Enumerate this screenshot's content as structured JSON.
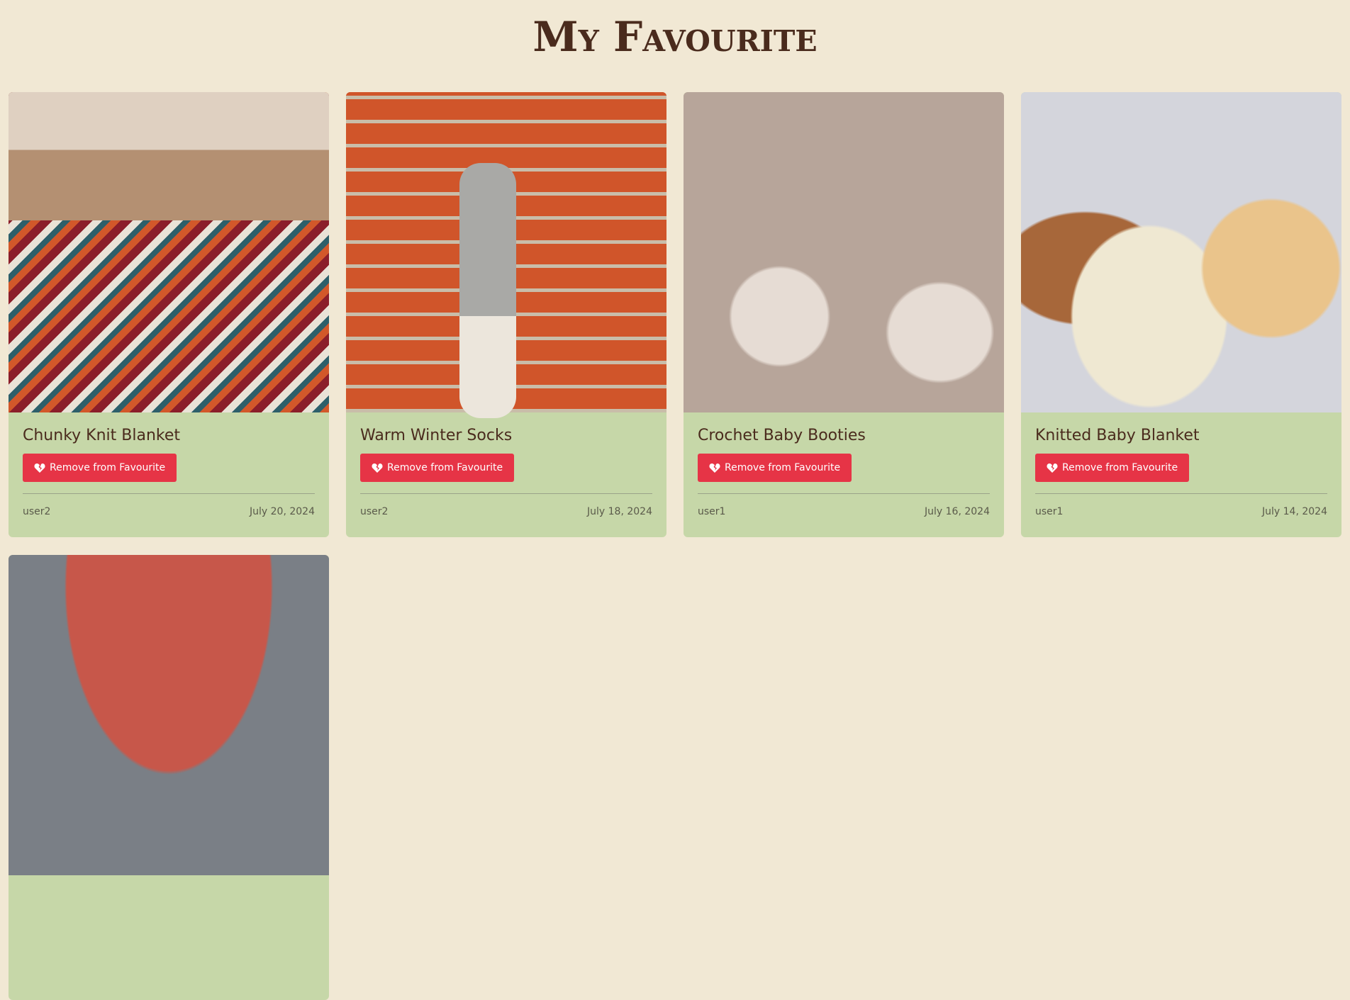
{
  "page": {
    "title": "My Favourite"
  },
  "cards": [
    {
      "title": "Chunky Knit Blanket",
      "button": "Remove from Favourite",
      "user": "user2",
      "date": "July 20, 2024"
    },
    {
      "title": "Warm Winter Socks",
      "button": "Remove from Favourite",
      "user": "user2",
      "date": "July 18, 2024"
    },
    {
      "title": "Crochet Baby Booties",
      "button": "Remove from Favourite",
      "user": "user1",
      "date": "July 16, 2024"
    },
    {
      "title": "Knitted Baby Blanket",
      "button": "Remove from Favourite",
      "user": "user1",
      "date": "July 14, 2024"
    }
  ],
  "colors": {
    "background": "#f1e8d4",
    "card": "#c6d7a8",
    "button": "#e63446",
    "heading": "#4a2b1d"
  }
}
